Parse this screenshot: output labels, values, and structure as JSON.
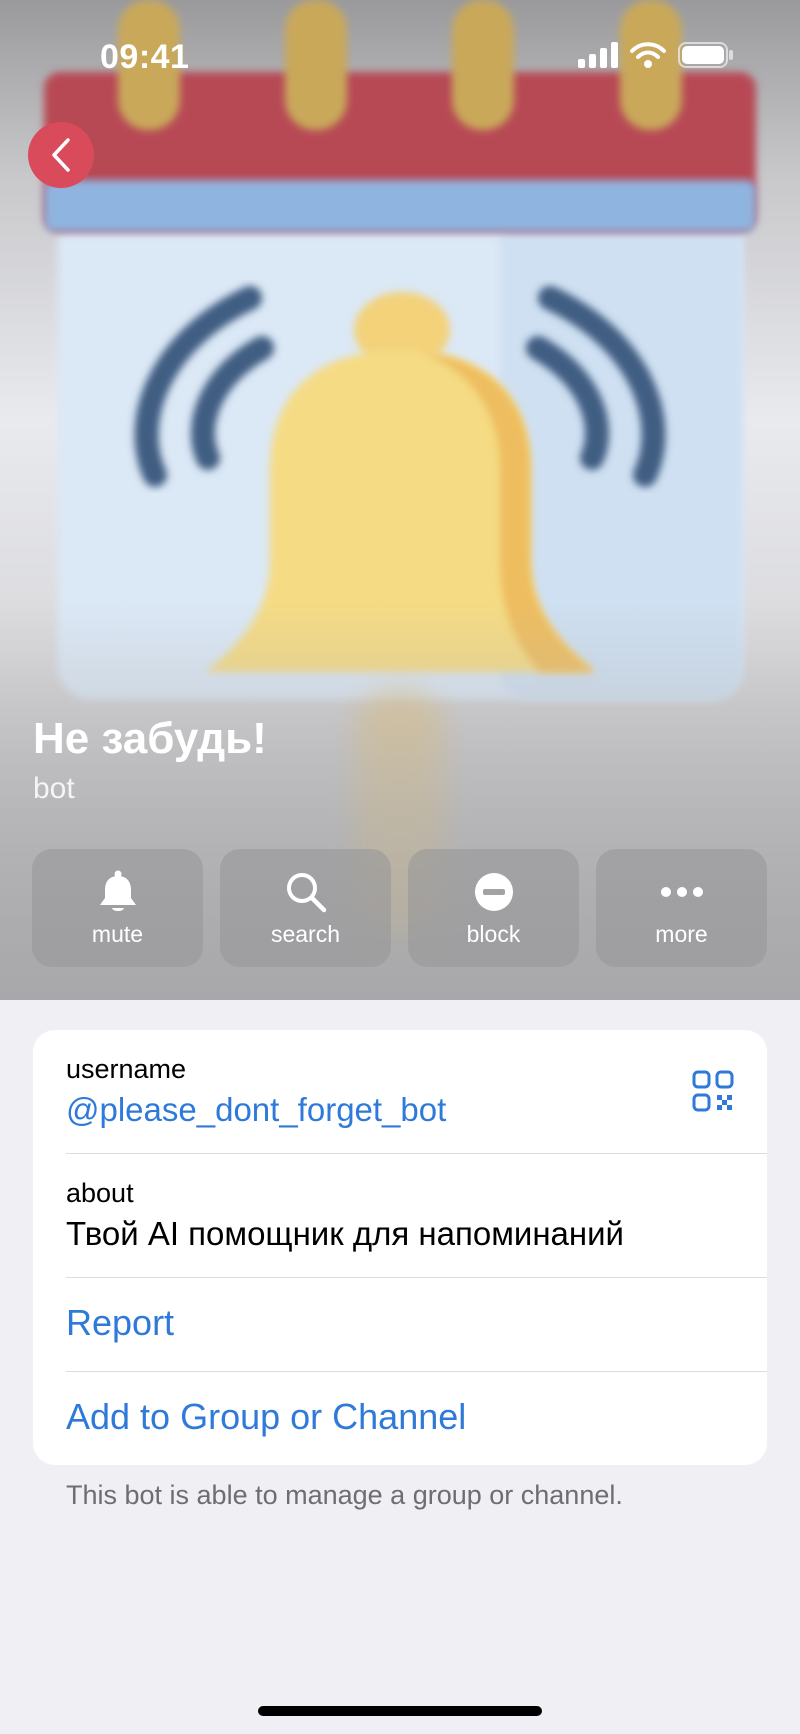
{
  "status_bar": {
    "time": "09:41"
  },
  "profile": {
    "name": "Не забудь!",
    "subtitle": "bot"
  },
  "actions": [
    {
      "label": "mute",
      "icon": "bell-icon"
    },
    {
      "label": "search",
      "icon": "search-icon"
    },
    {
      "label": "block",
      "icon": "block-icon"
    },
    {
      "label": "more",
      "icon": "more-icon"
    }
  ],
  "info": {
    "username_label": "username",
    "username_value": "@please_dont_forget_bot",
    "about_label": "about",
    "about_value": "Твой AI помощник для напоминаний",
    "report_label": "Report",
    "add_label": "Add to Group or Channel"
  },
  "footnote": "This bot is able to manage a group or channel.",
  "colors": {
    "accent": "#2f7ad9",
    "back_button": "#d94a5a",
    "background": "#efeff4"
  }
}
